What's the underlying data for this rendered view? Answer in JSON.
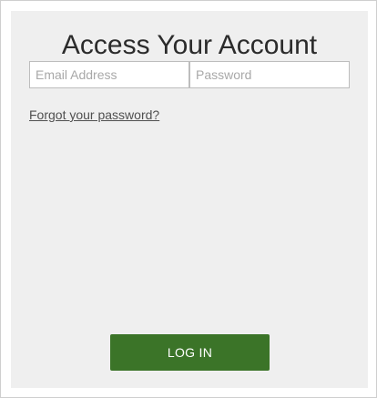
{
  "login_form": {
    "title": "Access Your Account",
    "email": {
      "value": "",
      "placeholder": "Email Address"
    },
    "password": {
      "value": "",
      "placeholder": "Password"
    },
    "forgot_password_label": "Forgot your password?",
    "login_label": "LOG IN"
  },
  "colors": {
    "panel_background": "#efefef",
    "button_background": "#3b7428",
    "button_text": "#ffffff",
    "title_text": "#2b2b2b",
    "link_text": "#505050"
  }
}
